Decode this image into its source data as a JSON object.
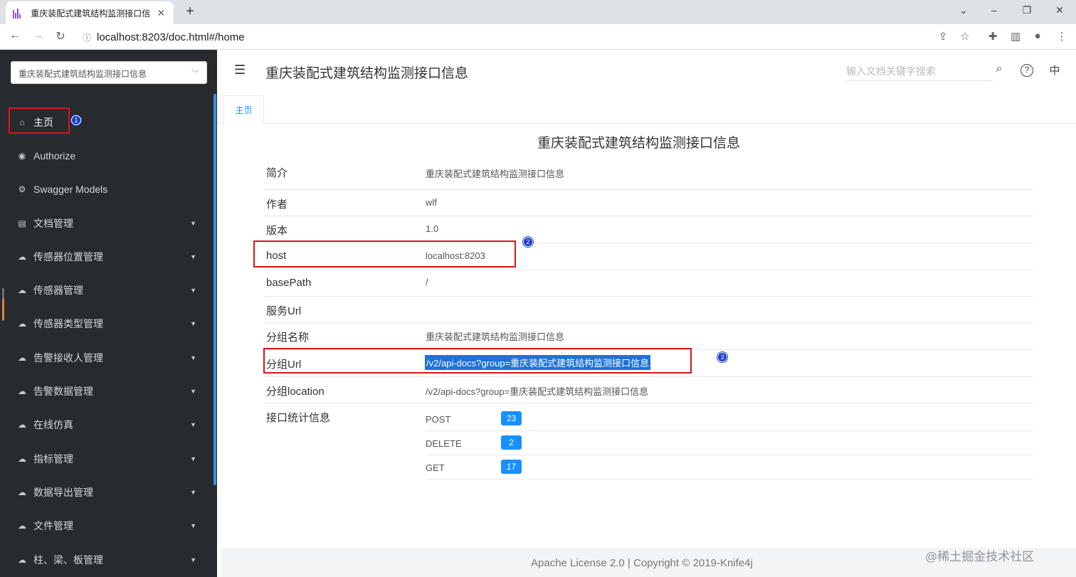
{
  "browser": {
    "tab_title": "重庆装配式建筑结构监测接口信息",
    "tab_close": "✕",
    "new_tab": "+",
    "url": "localhost:8203/doc.html#/home"
  },
  "sidebar": {
    "group_select_value": "重庆装配式建筑结构监测接口信息",
    "items": [
      {
        "label": "主页",
        "icon": "home-icon",
        "arrow": false
      },
      {
        "label": "Authorize",
        "icon": "lock-icon",
        "arrow": false
      },
      {
        "label": "Swagger Models",
        "icon": "gear-icon",
        "arrow": false
      },
      {
        "label": "文档管理",
        "icon": "doc-icon",
        "arrow": true
      },
      {
        "label": "传感器位置管理",
        "icon": "cloud-icon",
        "arrow": true
      },
      {
        "label": "传感器管理",
        "icon": "cloud-icon",
        "arrow": true
      },
      {
        "label": "传感器类型管理",
        "icon": "cloud-icon",
        "arrow": true
      },
      {
        "label": "告警接收人管理",
        "icon": "cloud-icon",
        "arrow": true
      },
      {
        "label": "告警数据管理",
        "icon": "cloud-icon",
        "arrow": true
      },
      {
        "label": "在线仿真",
        "icon": "cloud-icon",
        "arrow": true
      },
      {
        "label": "指标管理",
        "icon": "cloud-icon",
        "arrow": true
      },
      {
        "label": "数据导出管理",
        "icon": "cloud-icon",
        "arrow": true
      },
      {
        "label": "文件管理",
        "icon": "cloud-icon",
        "arrow": true
      },
      {
        "label": "柱、梁、板管理",
        "icon": "cloud-icon",
        "arrow": true
      }
    ]
  },
  "header": {
    "title": "重庆装配式建筑结构监测接口信息",
    "search_placeholder": "输入文档关键字搜索",
    "lang": "中"
  },
  "tabs": {
    "home": "主页"
  },
  "main": {
    "title": "重庆装配式建筑结构监测接口信息",
    "rows": [
      {
        "label": "简介",
        "value": "重庆装配式建筑结构监测接口信息"
      },
      {
        "label": "作者",
        "value": "wlf"
      },
      {
        "label": "版本",
        "value": "1.0"
      },
      {
        "label": "host",
        "value": "localhost:8203"
      },
      {
        "label": "basePath",
        "value": "/"
      },
      {
        "label": "服务Url",
        "value": ""
      },
      {
        "label": "分组名称",
        "value": "重庆装配式建筑结构监测接口信息"
      },
      {
        "label": "分组Url",
        "value": "/v2/api-docs?group=重庆装配式建筑结构监测接口信息"
      },
      {
        "label": "分组location",
        "value": "/v2/api-docs?group=重庆装配式建筑结构监测接口信息"
      },
      {
        "label": "接口统计信息",
        "value": ""
      }
    ],
    "stats": [
      {
        "method": "POST",
        "count": "23"
      },
      {
        "method": "DELETE",
        "count": "2"
      },
      {
        "method": "GET",
        "count": "17"
      }
    ]
  },
  "annotations": [
    "1",
    "2",
    "3"
  ],
  "footer": {
    "text": "Apache License 2.0 | Copyright © 2019-Knife4j",
    "watermark": "@稀土掘金技术社区"
  },
  "colors": {
    "sidebar_bg": "#272b30",
    "accent": "#1890ff",
    "annotation_red": "#d9151b",
    "annotation_blue": "#1a3dc7"
  }
}
